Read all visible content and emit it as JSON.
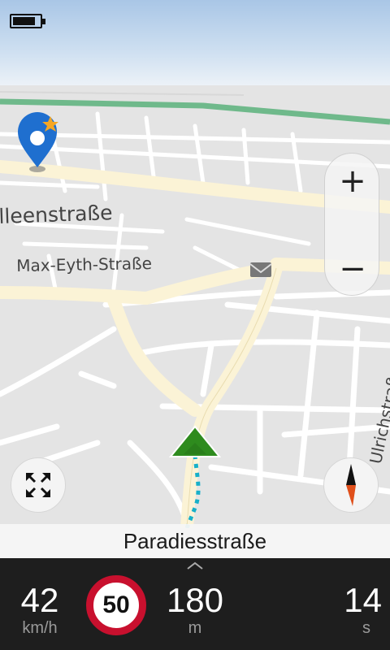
{
  "status_bar": {
    "battery_icon": "battery-icon",
    "battery_level": 0.85
  },
  "map": {
    "street_labels": {
      "alleen": "lleenstraße",
      "max_eyth": "Max-Eyth-Straße",
      "ulrich": "Ulrichstraße"
    },
    "destination_icon": "location-pin-icon",
    "favorite_icon": "star-icon",
    "poi_icon": "mail-icon",
    "position_icon": "navigation-arrow-icon"
  },
  "controls": {
    "zoom_in_label": "+",
    "zoom_out_label": "−",
    "fullscreen_icon": "expand-icon",
    "compass_icon": "compass-icon"
  },
  "current_street": "Paradiesstraße",
  "bottom": {
    "speed": {
      "value": "42",
      "unit": "km/h"
    },
    "speed_limit": "50",
    "distance": {
      "value": "180",
      "unit": "m"
    },
    "time": {
      "value": "14",
      "unit": "s"
    },
    "expand_icon": "chevron-up-icon"
  },
  "colors": {
    "route": "#17b0c9",
    "arrow": "#2e8b1e",
    "speed_limit_ring": "#c8102e",
    "main_road": "#fbf3d6",
    "railway": "#6fb98b"
  }
}
